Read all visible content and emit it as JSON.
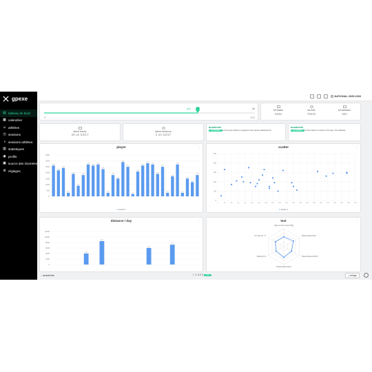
{
  "app": {
    "logo_text": "gpexe",
    "accent": "#2fd39b",
    "bar_color": "#5b9bef"
  },
  "sidebar": {
    "items": [
      {
        "label": "tableau de bord",
        "icon": "dashboard-icon",
        "active": true
      },
      {
        "label": "calendrier",
        "icon": "calendar-icon"
      },
      {
        "label": "athlètes",
        "icon": "athlete-icon"
      },
      {
        "label": "sessions",
        "icon": "session-icon"
      },
      {
        "label": "sessions athlètes",
        "icon": "athlete-session-icon"
      },
      {
        "label": "statistiques",
        "icon": "stats-icon"
      },
      {
        "label": "profils",
        "icon": "profile-icon"
      },
      {
        "label": "source des Données",
        "icon": "data-source-icon"
      },
      {
        "label": "réglages",
        "icon": "gear-icon"
      }
    ]
  },
  "topbar": {
    "season": "NATIONAL 2025-2026"
  },
  "slider": {
    "min": "0",
    "max": "372",
    "handle_label": "jour",
    "right_label": "-lia"
  },
  "totals": [
    {
      "label": "tot tracks",
      "value": "5349",
      "icon": "tracks-icon"
    },
    {
      "label": "tot time",
      "value": "7001h",
      "icon": "clock-icon"
    },
    {
      "label": "tot sessions",
      "value": "503",
      "icon": "sessions-icon"
    }
  ],
  "latest": [
    {
      "label": "latest tracks",
      "value": "40 on 03/17"
    },
    {
      "label": "latest sessions",
      "value": "2 on 03/17"
    }
  ],
  "notices": [
    {
      "title": "academie",
      "badge": "ACADEMIE",
      "text": "(3) the guest athlete is registered. New session dashboard for"
    },
    {
      "title": "academie",
      "badge": "ACADEMIE",
      "text": "(3) New field for contacts in the layer. The database"
    }
  ],
  "charts": {
    "player": {
      "title": "player",
      "legend": "series 1"
    },
    "scatter": {
      "title": "scatter",
      "legend": "series 1"
    },
    "distance": {
      "title": "distance / day"
    },
    "test": {
      "title": "test"
    }
  },
  "bottom": {
    "team": "academie",
    "version": "v. 3.2.4",
    "version_badge": "new",
    "bridge": "bridge"
  },
  "chart_data": [
    {
      "type": "bar",
      "title": "player",
      "ylim": [
        0,
        3500
      ],
      "yticks": [
        "0",
        "500",
        "1000",
        "1500",
        "2000",
        "2500",
        "3000",
        "3500"
      ],
      "legend": "series 1",
      "values": [
        2600,
        2200,
        2400,
        300,
        1900,
        900,
        1800,
        2700,
        2600,
        2700,
        2300,
        300,
        1800,
        1500,
        2900,
        2500,
        200,
        2100,
        2600,
        2800,
        2700,
        1900,
        2500,
        300,
        1700,
        2700,
        300,
        1500,
        1200,
        1800
      ]
    },
    {
      "type": "scatter",
      "title": "scatter",
      "legend": "series 1",
      "xlim": [
        0,
        400
      ],
      "ylim": [
        0,
        500
      ],
      "xticks": [
        "0",
        "20",
        "40",
        "60",
        "80",
        "100",
        "120",
        "140",
        "160",
        "180",
        "200",
        "220",
        "240",
        "260",
        "280",
        "300",
        "320",
        "340",
        "360",
        "380",
        "400"
      ],
      "yticks": [
        "0",
        "100",
        "200",
        "300",
        "400",
        "500"
      ],
      "points": [
        [
          20,
          330
        ],
        [
          90,
          350
        ],
        [
          135,
          330
        ],
        [
          190,
          320
        ],
        [
          130,
          270
        ],
        [
          70,
          250
        ],
        [
          160,
          240
        ],
        [
          55,
          210
        ],
        [
          120,
          220
        ],
        [
          115,
          180
        ],
        [
          165,
          190
        ],
        [
          75,
          200
        ],
        [
          95,
          190
        ],
        [
          40,
          170
        ],
        [
          110,
          150
        ],
        [
          150,
          150
        ],
        [
          150,
          130
        ],
        [
          215,
          190
        ],
        [
          175,
          100
        ],
        [
          220,
          150
        ],
        [
          230,
          110
        ],
        [
          290,
          310
        ],
        [
          335,
          290
        ],
        [
          315,
          260
        ],
        [
          375,
          300
        ],
        [
          375,
          290
        ],
        [
          10,
          50
        ]
      ]
    },
    {
      "type": "bar",
      "title": "distance / day",
      "ylim": [
        0,
        12000
      ],
      "yticks": [
        "0",
        "2000",
        "4000",
        "6000",
        "8000",
        "10000",
        "12000"
      ],
      "values": [
        0,
        0,
        0,
        0,
        4000,
        0,
        8500,
        0,
        0,
        0,
        0,
        0,
        6000,
        0,
        0,
        7200,
        0,
        0,
        0
      ]
    },
    {
      "type": "radar",
      "title": "test",
      "axes": [
        "high set norm power [25g]",
        "DistanceSpeed [%]",
        "DistanceSpeed [km/h]",
        "DistanceSpeed [km]",
        "Distance [m]",
        "ac index [Ir] - %"
      ],
      "values": [
        0.55,
        0.62,
        0.5,
        0.6,
        0.5,
        0.55
      ]
    }
  ]
}
